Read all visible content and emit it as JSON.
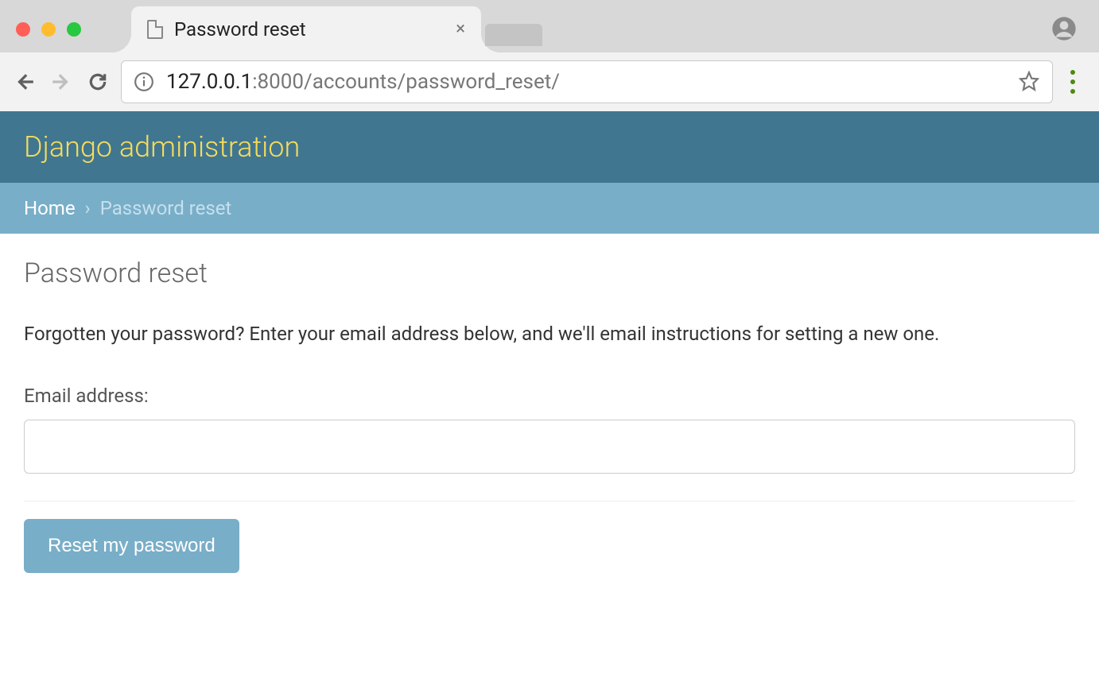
{
  "browser": {
    "tab_title": "Password reset",
    "url_host": "127.0.0.1",
    "url_path": ":8000/accounts/password_reset/"
  },
  "header": {
    "site_title": "Django administration"
  },
  "breadcrumbs": {
    "home": "Home",
    "separator": "›",
    "current": "Password reset"
  },
  "page": {
    "title": "Password reset",
    "help_text": "Forgotten your password? Enter your email address below, and we'll email instructions for setting a new one.",
    "email_label": "Email address:",
    "email_value": "",
    "submit_label": "Reset my password"
  }
}
